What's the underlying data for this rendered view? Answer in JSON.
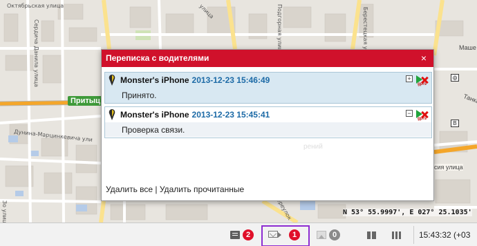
{
  "map": {
    "street_labels": [
      "Октябрьская улица",
      "Сердича Данила улица",
      "Дунина-Марцинкевича ули",
      "улица",
      "переулок",
      "Машер",
      "Танка",
      "сия улица",
      "Зо улица",
      "Подгорная улица",
      "Берестецкая улица"
    ],
    "pritych_label": "Притыц",
    "mashe_label": "Маше",
    "tanka_label": "Танка",
    "ulica_label": "сия улица",
    "coordinates": "N 53° 55.9997', E 027° 25.1035'",
    "mini_box_1": "ф",
    "mini_box_2": "В",
    "ghost_text": "рений",
    "colors": {
      "background": "#e8e5df",
      "road_major": "#f4a62a",
      "road_minor": "#ffffff",
      "road_yellow": "#fbe28e",
      "green_label": "#3f9a3a"
    }
  },
  "dialog": {
    "title": "Переписка с водителями",
    "close_label": "×",
    "header_color": "#d0112b",
    "messages": [
      {
        "sender": "Monster's iPhone",
        "timestamp": "2013-12-23 15:46:49",
        "text": "Принято.",
        "toggle": "⊞",
        "gprs_label": "gprs",
        "selected": true
      },
      {
        "sender": "Monster's iPhone",
        "timestamp": "2013-12-23 15:45:41",
        "text": "Проверка связи.",
        "toggle": "⊟",
        "gprs_label": "gprs",
        "selected": false
      }
    ],
    "footer": {
      "delete_all": "Удалить все",
      "separator": "|",
      "delete_read": "Удалить прочитанные"
    }
  },
  "statusbar": {
    "messages_badge": "2",
    "mail_badge": "1",
    "photo_badge": "0",
    "time": "15:43:32 (+03",
    "icons": [
      "messages-icon",
      "outgoing-mail-icon",
      "photo-icon",
      "list-view-icon",
      "map-view-icon"
    ],
    "highlight_color": "#8d2cd1"
  }
}
